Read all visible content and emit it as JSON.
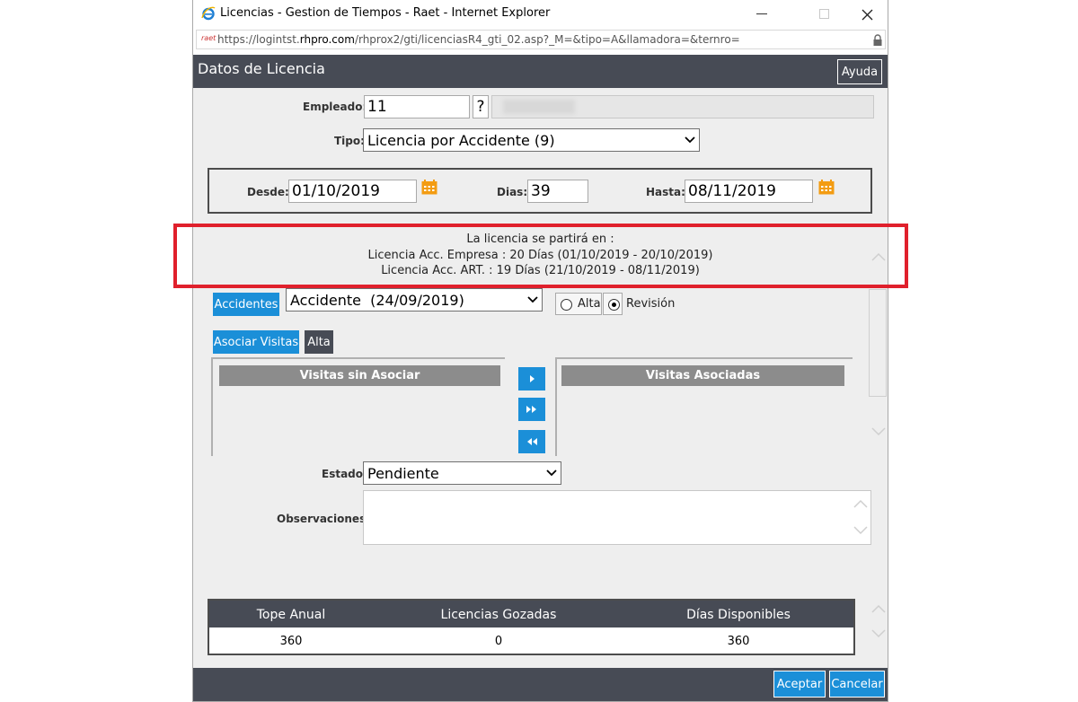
{
  "window": {
    "title": "Licencias - Gestion de Tiempos - Raet - Internet Explorer",
    "url_prefix": "https://logintst.",
    "url_domain": "rhpro.com",
    "url_rest": "/rhprox2/gti/licenciasR4_gti_02.asp?_M=&tipo=A&llamadora=&ternro=",
    "favicon_text": "raet"
  },
  "header": {
    "title": "Datos de Licencia",
    "help_button": "Ayuda"
  },
  "form": {
    "empleado_label": "Empleado:",
    "empleado_value": "11",
    "help_q": "?",
    "tipo_label": "Tipo:",
    "tipo_value": "Licencia por Accidente (9)",
    "desde_label": "Desde:",
    "desde_value": "01/10/2019",
    "dias_label": "Dias:",
    "dias_value": "39",
    "hasta_label": "Hasta:",
    "hasta_value": "08/11/2019"
  },
  "split_info": {
    "line1": "La licencia se partirá en :",
    "line2": "Licencia Acc. Empresa : 20 Días (01/10/2019 - 20/10/2019)",
    "line3": "Licencia Acc. ART. : 19 Días (21/10/2019 - 08/11/2019)"
  },
  "accidentes": {
    "button": "Accidentes",
    "selected": "Accidente  (24/09/2019)",
    "radio_alta": "Alta",
    "radio_revision": "Revisión",
    "selected_radio": "Revisión"
  },
  "visitas": {
    "asociar_button": "Asociar Visitas",
    "alta_button": "Alta",
    "left_header": "Visitas sin Asociar",
    "right_header": "Visitas Asociadas"
  },
  "estado": {
    "label": "Estado:",
    "value": "Pendiente"
  },
  "observaciones": {
    "label": "Observaciones:",
    "value": ""
  },
  "summary": {
    "headers": [
      "Tope Anual",
      "Licencias Gozadas",
      "Días Disponibles"
    ],
    "values": [
      "360",
      "0",
      "360"
    ]
  },
  "footer": {
    "accept": "Aceptar",
    "cancel": "Cancelar"
  },
  "colors": {
    "accent": "#1b8fd8",
    "header": "#474b55",
    "highlight": "#e0202c"
  },
  "icons": [
    "ie-icon",
    "lock-icon",
    "calendar-icon",
    "chevron-down-icon",
    "arrow-right-icon",
    "double-arrow-right-icon",
    "double-arrow-left-icon"
  ]
}
